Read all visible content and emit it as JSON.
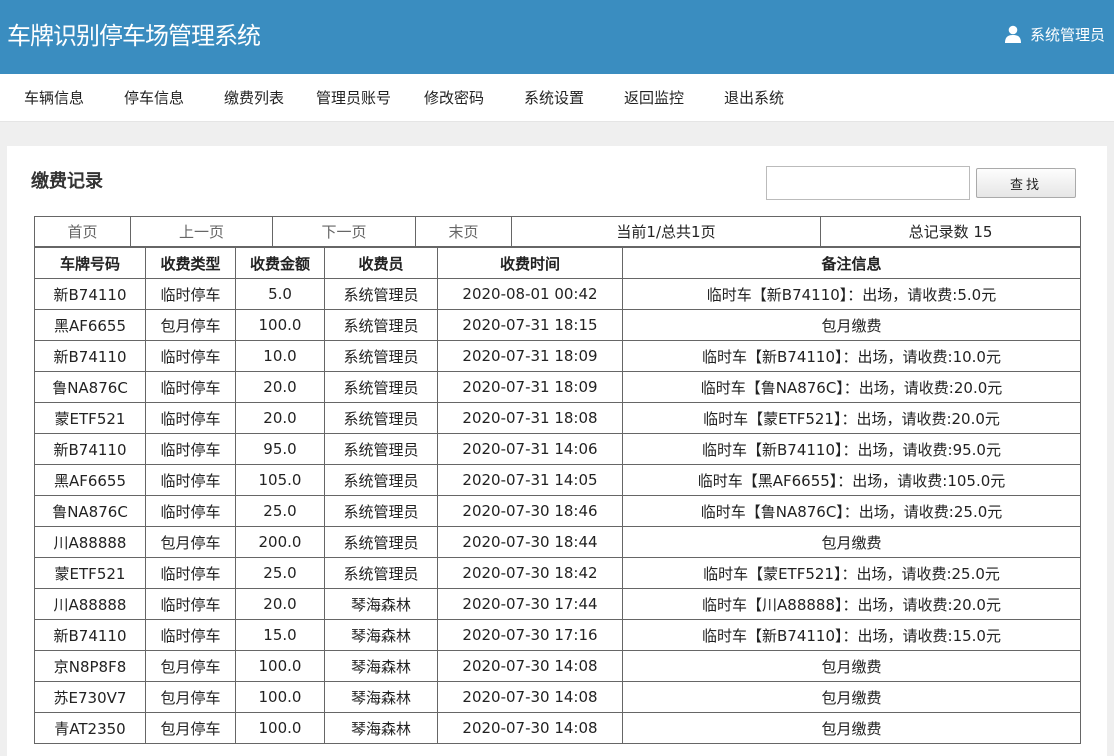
{
  "header": {
    "title": "车牌识别停车场管理系统",
    "user_name": "系统管理员",
    "user_icon": "user-icon"
  },
  "nav": {
    "items": [
      "车辆信息",
      "停车信息",
      "缴费列表",
      "管理员账号",
      "修改密码",
      "系统设置",
      "返回监控",
      "退出系统"
    ]
  },
  "page": {
    "title": "缴费记录",
    "search": {
      "value": "",
      "placeholder": "",
      "button_label": "查找"
    }
  },
  "pager": {
    "first": "首页",
    "prev": "上一页",
    "next": "下一页",
    "last": "末页",
    "page_info": "当前1/总共1页",
    "total_info": "总记录数 15"
  },
  "table": {
    "headers": [
      "车牌号码",
      "收费类型",
      "收费金额",
      "收费员",
      "收费时间",
      "备注信息"
    ],
    "rows": [
      [
        "新B74110",
        "临时停车",
        "5.0",
        "系统管理员",
        "2020-08-01 00:42",
        "临时车【新B74110】：出场，请收费:5.0元"
      ],
      [
        "黑AF6655",
        "包月停车",
        "100.0",
        "系统管理员",
        "2020-07-31 18:15",
        "包月缴费"
      ],
      [
        "新B74110",
        "临时停车",
        "10.0",
        "系统管理员",
        "2020-07-31 18:09",
        "临时车【新B74110】：出场，请收费:10.0元"
      ],
      [
        "鲁NA876C",
        "临时停车",
        "20.0",
        "系统管理员",
        "2020-07-31 18:09",
        "临时车【鲁NA876C】：出场，请收费:20.0元"
      ],
      [
        "蒙ETF521",
        "临时停车",
        "20.0",
        "系统管理员",
        "2020-07-31 18:08",
        "临时车【蒙ETF521】：出场，请收费:20.0元"
      ],
      [
        "新B74110",
        "临时停车",
        "95.0",
        "系统管理员",
        "2020-07-31 14:06",
        "临时车【新B74110】：出场，请收费:95.0元"
      ],
      [
        "黑AF6655",
        "临时停车",
        "105.0",
        "系统管理员",
        "2020-07-31 14:05",
        "临时车【黑AF6655】：出场，请收费:105.0元"
      ],
      [
        "鲁NA876C",
        "临时停车",
        "25.0",
        "系统管理员",
        "2020-07-30 18:46",
        "临时车【鲁NA876C】：出场，请收费:25.0元"
      ],
      [
        "川A88888",
        "包月停车",
        "200.0",
        "系统管理员",
        "2020-07-30 18:44",
        "包月缴费"
      ],
      [
        "蒙ETF521",
        "临时停车",
        "25.0",
        "系统管理员",
        "2020-07-30 18:42",
        "临时车【蒙ETF521】：出场，请收费:25.0元"
      ],
      [
        "川A88888",
        "临时停车",
        "20.0",
        "琴海森林",
        "2020-07-30 17:44",
        "临时车【川A88888】：出场，请收费:20.0元"
      ],
      [
        "新B74110",
        "临时停车",
        "15.0",
        "琴海森林",
        "2020-07-30 17:16",
        "临时车【新B74110】：出场，请收费:15.0元"
      ],
      [
        "京N8P8F8",
        "包月停车",
        "100.0",
        "琴海森林",
        "2020-07-30 14:08",
        "包月缴费"
      ],
      [
        "苏E730V7",
        "包月停车",
        "100.0",
        "琴海森林",
        "2020-07-30 14:08",
        "包月缴费"
      ],
      [
        "青AT2350",
        "包月停车",
        "100.0",
        "琴海森林",
        "2020-07-30 14:08",
        "包月缴费"
      ]
    ]
  },
  "colors": {
    "header_bg": "#3a8dc0",
    "page_bg": "#efefef"
  }
}
